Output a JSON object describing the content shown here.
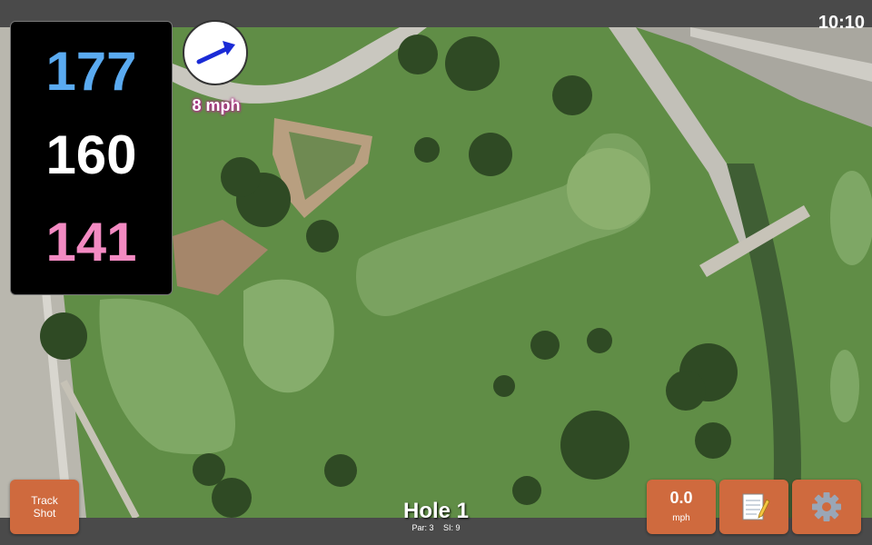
{
  "status": {
    "time": "10:10"
  },
  "distances": {
    "back": "177",
    "middle": "160",
    "front": "141"
  },
  "wind": {
    "speed": "8 mph",
    "icon": "wind-arrow-icon"
  },
  "hole": {
    "title": "Hole 1",
    "par": "Par: 3",
    "si": "SI: 9"
  },
  "buttons": {
    "track_shot": [
      "Track",
      "Shot"
    ],
    "speed_value": "0.0",
    "speed_unit": "mph",
    "notes_icon": "notepad-icon",
    "settings_icon": "gear-icon"
  },
  "colors": {
    "back": "#5aaaf0",
    "middle": "#ffffff",
    "front": "#f38ac2",
    "button": "#cf6a3e",
    "bar": "#4a4a4a"
  }
}
